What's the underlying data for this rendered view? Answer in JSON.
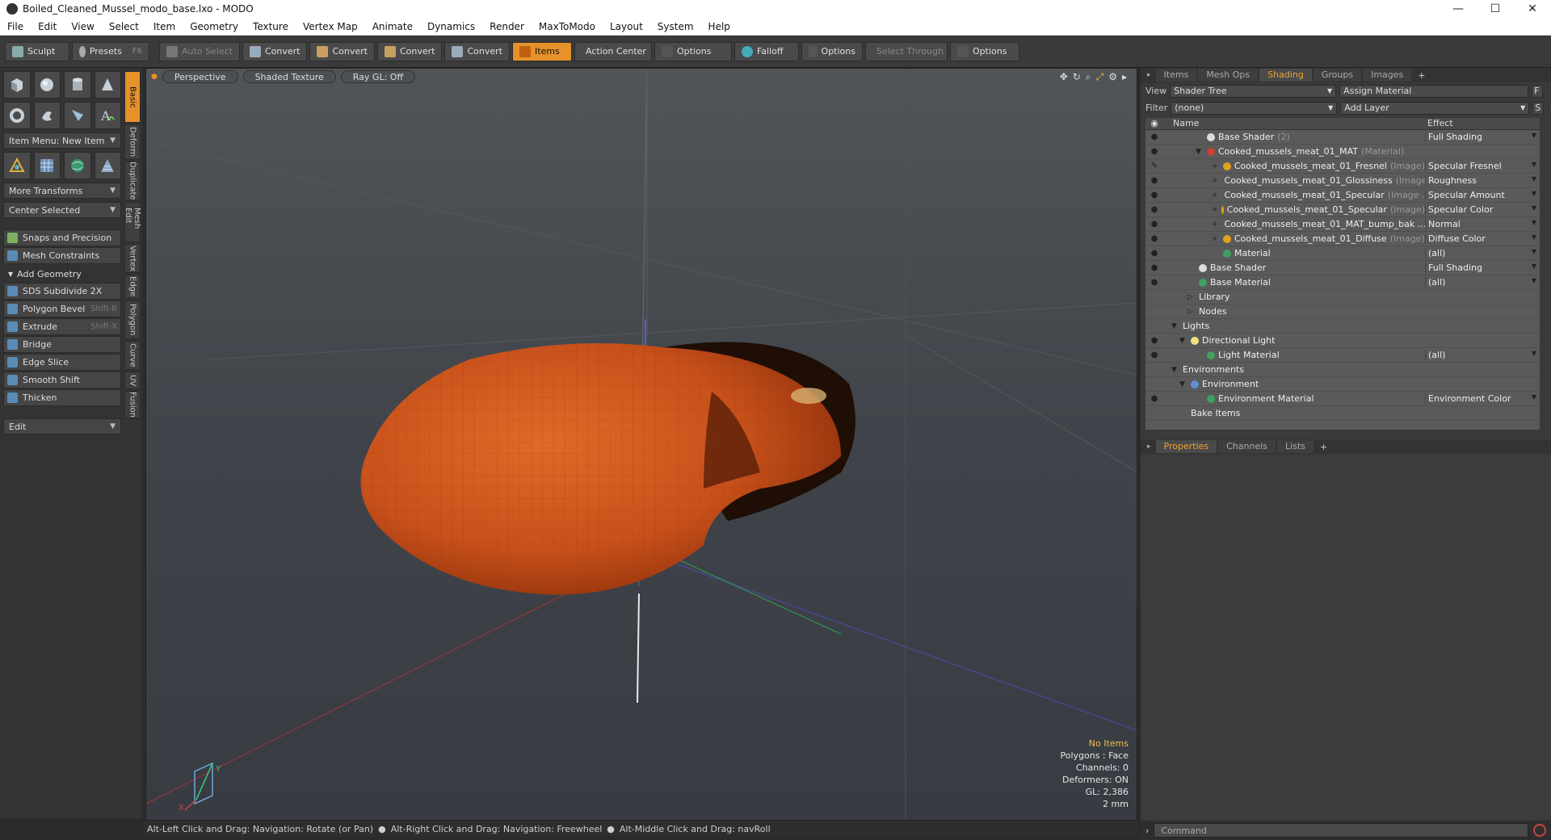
{
  "window": {
    "title": "Boiled_Cleaned_Mussel_modo_base.lxo - MODO",
    "minimize": "—",
    "maximize": "☐",
    "close": "✕"
  },
  "menu": [
    "File",
    "Edit",
    "View",
    "Select",
    "Item",
    "Geometry",
    "Texture",
    "Vertex Map",
    "Animate",
    "Dynamics",
    "Render",
    "MaxToModo",
    "Layout",
    "System",
    "Help"
  ],
  "toolbar": {
    "sculpt": "Sculpt",
    "presets": "Presets",
    "presets_key": "F6",
    "auto_select": "Auto Select",
    "convert": "Convert",
    "items": "Items",
    "action_center": "Action Center",
    "options": "Options",
    "falloff": "Falloff",
    "select_through": "Select Through"
  },
  "left": {
    "item_menu": "Item Menu: New Item",
    "more_transforms": "More Transforms",
    "center_selected": "Center Selected",
    "snaps": "Snaps and Precision",
    "mesh_constraints": "Mesh Constraints",
    "add_geometry": "Add Geometry",
    "tools": [
      {
        "label": "SDS Subdivide 2X",
        "key": ""
      },
      {
        "label": "Polygon Bevel",
        "key": "Shift-B"
      },
      {
        "label": "Extrude",
        "key": "Shift-X"
      },
      {
        "label": "Bridge",
        "key": ""
      },
      {
        "label": "Edge Slice",
        "key": ""
      },
      {
        "label": "Smooth Shift",
        "key": ""
      },
      {
        "label": "Thicken",
        "key": ""
      }
    ],
    "edit": "Edit",
    "vtabs": [
      "Basic",
      "Deform",
      "Duplicate",
      "Mesh Edit",
      "Vertex",
      "Edge",
      "Polygon",
      "Curve",
      "UV",
      "Fusion"
    ]
  },
  "viewport": {
    "perspective": "Perspective",
    "shaded": "Shaded Texture",
    "raygl": "Ray GL: Off",
    "stats": {
      "items": "No Items",
      "polygons": "Polygons : Face",
      "channels": "Channels: 0",
      "deformers": "Deformers: ON",
      "gl": "GL: 2,386",
      "scale": "2 mm"
    },
    "axis_y": "Y",
    "axis_x": "X"
  },
  "status": {
    "a": "Alt-Left Click and Drag: Navigation: Rotate (or Pan)",
    "b": "Alt-Right Click and Drag: Navigation: Freewheel",
    "c": "Alt-Middle Click and Drag: navRoll"
  },
  "right": {
    "tabs": [
      "Items",
      "Mesh Ops",
      "Shading",
      "Groups",
      "Images"
    ],
    "view_label": "View",
    "view_value": "Shader Tree",
    "assign_material": "Assign Material",
    "filter_label": "Filter",
    "filter_value": "(none)",
    "add_layer": "Add Layer",
    "col_name": "Name",
    "col_effect": "Effect",
    "rows": [
      {
        "name": "Base Shader",
        "type": "(2)",
        "effect": "Full Shading",
        "indent": 40,
        "color": "#dddddd",
        "eye": "●",
        "expand": ""
      },
      {
        "name": "Cooked_mussels_meat_01_MAT",
        "type": "(Material)",
        "effect": "",
        "indent": 40,
        "color": "#c84030",
        "eye": "●",
        "expand": "▼"
      },
      {
        "name": "Cooked_mussels_meat_01_Fresnel",
        "type": "(Image)",
        "effect": "Specular Fresnel",
        "indent": 60,
        "color": "#e0a020",
        "eye": "✎",
        "expand": "+"
      },
      {
        "name": "Cooked_mussels_meat_01_Glossiness",
        "type": "(Image)",
        "effect": "Roughness",
        "indent": 60,
        "color": "#e0a020",
        "eye": "●",
        "expand": "+"
      },
      {
        "name": "Cooked_mussels_meat_01_Specular",
        "type": "(Image ...",
        "effect": "Specular Amount",
        "indent": 60,
        "color": "#e0a020",
        "eye": "●",
        "expand": "+"
      },
      {
        "name": "Cooked_mussels_meat_01_Specular",
        "type": "(Image)",
        "effect": "Specular Color",
        "indent": 60,
        "color": "#e0a020",
        "eye": "●",
        "expand": "+"
      },
      {
        "name": "Cooked_mussels_meat_01_MAT_bump_bak ...",
        "type": "",
        "effect": "Normal",
        "indent": 60,
        "color": "#e0a020",
        "eye": "●",
        "expand": "+"
      },
      {
        "name": "Cooked_mussels_meat_01_Diffuse",
        "type": "(Image)",
        "effect": "Diffuse Color",
        "indent": 60,
        "color": "#e0a020",
        "eye": "●",
        "expand": "+"
      },
      {
        "name": "Material",
        "type": "",
        "effect": "(all)",
        "indent": 60,
        "color": "#40a060",
        "eye": "●",
        "expand": ""
      },
      {
        "name": "Base Shader",
        "type": "",
        "effect": "Full Shading",
        "indent": 30,
        "color": "#dddddd",
        "eye": "●",
        "expand": ""
      },
      {
        "name": "Base Material",
        "type": "",
        "effect": "(all)",
        "indent": 30,
        "color": "#40a060",
        "eye": "●",
        "expand": ""
      },
      {
        "name": "Library",
        "type": "",
        "effect": "",
        "indent": 30,
        "color": "",
        "eye": "",
        "expand": "▷"
      },
      {
        "name": "Nodes",
        "type": "",
        "effect": "",
        "indent": 30,
        "color": "",
        "eye": "",
        "expand": "▷"
      },
      {
        "name": "Lights",
        "type": "",
        "effect": "",
        "indent": 10,
        "color": "",
        "eye": "",
        "expand": "▼"
      },
      {
        "name": "Directional Light",
        "type": "",
        "effect": "",
        "indent": 20,
        "color": "#f0e080",
        "eye": "●",
        "expand": "▼"
      },
      {
        "name": "Light Material",
        "type": "",
        "effect": "(all)",
        "indent": 40,
        "color": "#40a060",
        "eye": "●",
        "expand": ""
      },
      {
        "name": "Environments",
        "type": "",
        "effect": "",
        "indent": 10,
        "color": "",
        "eye": "",
        "expand": "▼"
      },
      {
        "name": "Environment",
        "type": "",
        "effect": "",
        "indent": 20,
        "color": "#6090d0",
        "eye": "",
        "expand": "▼"
      },
      {
        "name": "Environment Material",
        "type": "",
        "effect": "Environment Color",
        "indent": 40,
        "color": "#40a060",
        "eye": "●",
        "expand": ""
      },
      {
        "name": "Bake Items",
        "type": "",
        "effect": "",
        "indent": 20,
        "color": "",
        "eye": "",
        "expand": ""
      }
    ],
    "props_tabs": [
      "Properties",
      "Channels",
      "Lists"
    ],
    "command_placeholder": "Command"
  },
  "colors": {
    "accent": "#e6912a",
    "mussel": "#c8501a"
  }
}
